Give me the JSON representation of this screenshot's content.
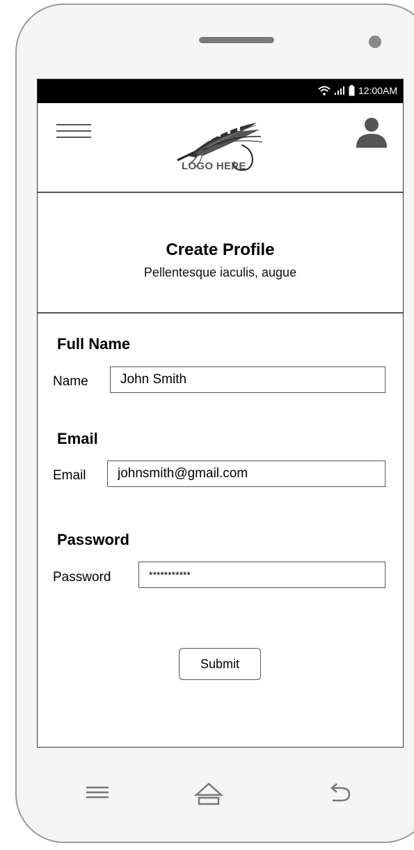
{
  "status_bar": {
    "time": "12:00AM"
  },
  "app_bar": {
    "logo_text": "LOGO HERE"
  },
  "header": {
    "title": "Create Profile",
    "subtitle": "Pellentesque iaculis, augue"
  },
  "form": {
    "full_name": {
      "section_title": "Full Name",
      "label": "Name",
      "value": "John Smith"
    },
    "email": {
      "section_title": "Email",
      "label": "Email",
      "value": "johnsmith@gmail.com"
    },
    "password": {
      "section_title": "Password",
      "label": "Password",
      "value": "***********"
    },
    "submit_label": "Submit"
  },
  "icons": {
    "menu": "hamburger-menu-icon",
    "user": "user-profile-icon",
    "wifi": "wifi-icon",
    "signal": "signal-icon",
    "battery": "battery-icon",
    "nav_menu": "menu-icon",
    "nav_home": "home-icon",
    "nav_back": "back-icon"
  },
  "colors": {
    "status_bar": "#000000",
    "divider": "#555555",
    "device": "#f5f5f5"
  }
}
